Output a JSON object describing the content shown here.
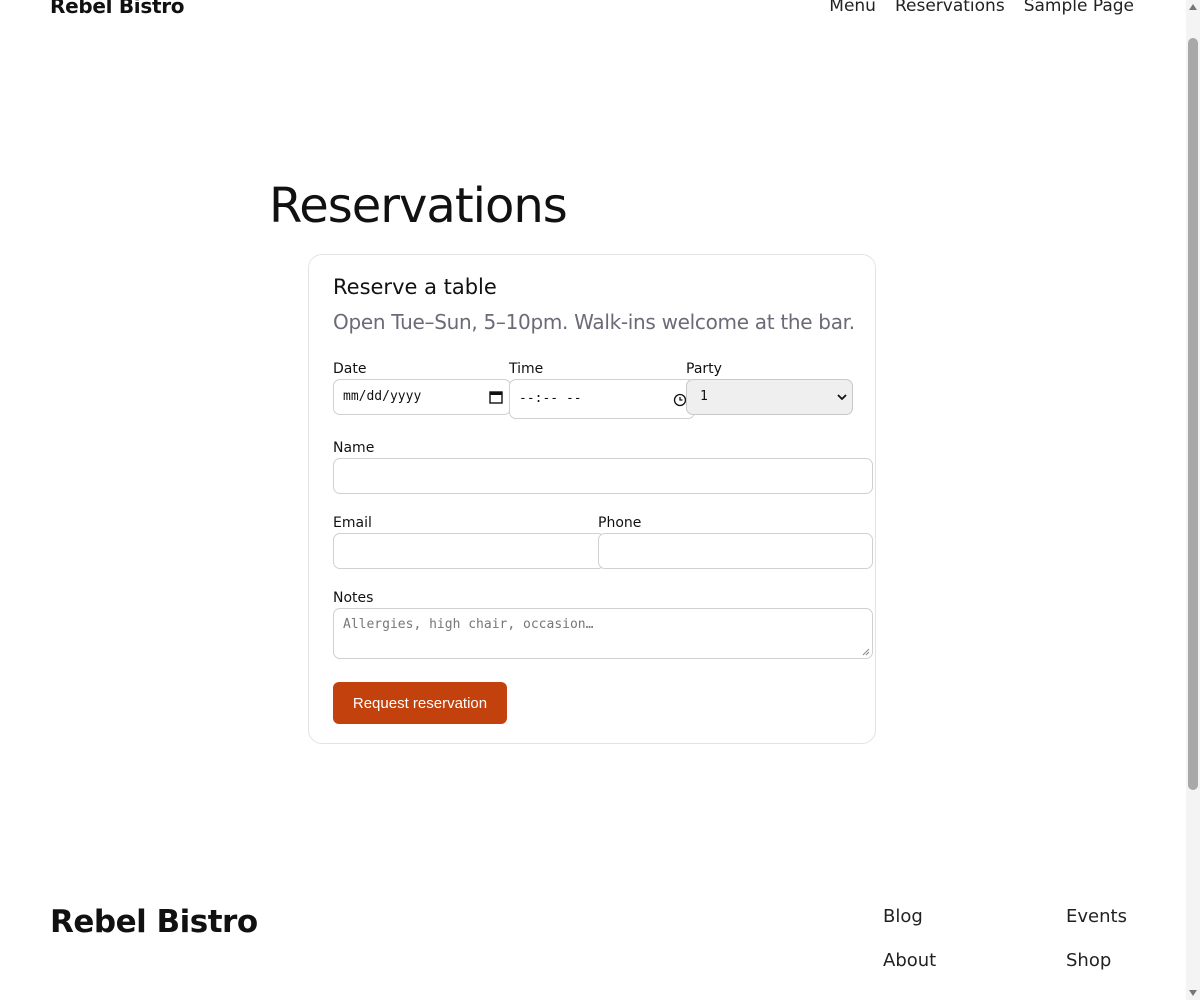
{
  "header": {
    "site_title": "Rebel Bistro",
    "nav": [
      "Menu",
      "Reservations",
      "Sample Page"
    ]
  },
  "page": {
    "title": "Reservations"
  },
  "form": {
    "title": "Reserve a table",
    "subtitle": "Open Tue–Sun, 5–10pm. Walk-ins welcome at the bar.",
    "date_label": "Date",
    "date_placeholder": "mm/dd/yyyy",
    "time_label": "Time",
    "time_placeholder": "--:-- --",
    "party_label": "Party",
    "party_value": "1",
    "name_label": "Name",
    "name_value": "",
    "email_label": "Email",
    "email_value": "",
    "phone_label": "Phone",
    "phone_value": "",
    "notes_label": "Notes",
    "notes_placeholder": "Allergies, high chair, occasion…",
    "submit_label": "Request reservation"
  },
  "footer": {
    "site_title": "Rebel Bistro",
    "links": [
      "Blog",
      "About",
      "Events",
      "Shop"
    ]
  },
  "colors": {
    "accent": "#c2410c",
    "muted_text": "#6b6b78",
    "border": "#d0d0d0"
  }
}
